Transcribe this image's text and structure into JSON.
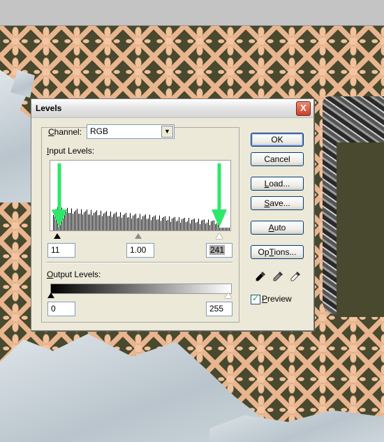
{
  "dialog": {
    "title": "Levels",
    "close_glyph": "X"
  },
  "channel": {
    "label_underlined": "C",
    "label_rest": "hannel:",
    "value": "RGB"
  },
  "input_levels": {
    "label_underlined": "I",
    "label_rest": "nput Levels:",
    "black": "11",
    "gamma": "1.00",
    "white": "241"
  },
  "output_levels": {
    "label_underlined": "O",
    "label_rest": "utput Levels:",
    "black": "0",
    "white": "255"
  },
  "buttons": {
    "ok": "OK",
    "cancel": "Cancel",
    "load_u": "L",
    "load_rest": "oad...",
    "save_u": "S",
    "save_rest": "ave...",
    "auto_u": "A",
    "auto_rest": "uto",
    "options_u": "T",
    "options_pre": "Op",
    "options_rest": "ions..."
  },
  "preview": {
    "label_underlined": "P",
    "label_rest": "review",
    "checked": true
  },
  "icons": [
    "close-icon",
    "chevron-down-icon",
    "black-eyedropper-icon",
    "gray-eyedropper-icon",
    "white-eyedropper-icon",
    "checkmark-icon"
  ],
  "colors": {
    "annotation_arrow": "#2ee86a",
    "dialog_bg": "#ece9d8",
    "close_button": "#c9402a"
  }
}
